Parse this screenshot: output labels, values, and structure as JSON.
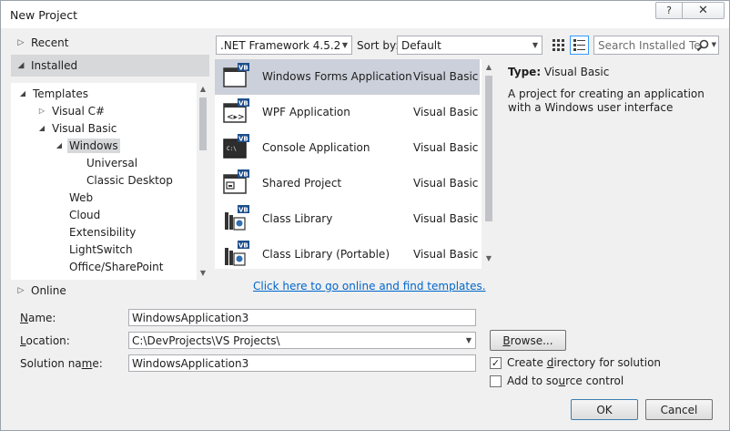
{
  "window": {
    "title": "New Project",
    "help_glyph": "?",
    "close_glyph": "✕"
  },
  "nav": {
    "sections": [
      {
        "label": "Recent",
        "arrow": "▷"
      },
      {
        "label": "Installed",
        "arrow": "◢"
      },
      {
        "label": "Online",
        "arrow": "▷"
      }
    ],
    "tree": [
      {
        "label": "Templates",
        "arrow": "◢",
        "level": 0
      },
      {
        "label": "Visual C#",
        "arrow": "▷",
        "level": 1
      },
      {
        "label": "Visual Basic",
        "arrow": "◢",
        "level": 1
      },
      {
        "label": "Windows",
        "arrow": "◢",
        "level": 2,
        "selected": true
      },
      {
        "label": "Universal",
        "arrow": "",
        "level": 3
      },
      {
        "label": "Classic Desktop",
        "arrow": "",
        "level": 3
      },
      {
        "label": "Web",
        "arrow": "",
        "level": 2
      },
      {
        "label": "Cloud",
        "arrow": "",
        "level": 2
      },
      {
        "label": "Extensibility",
        "arrow": "",
        "level": 2
      },
      {
        "label": "LightSwitch",
        "arrow": "",
        "level": 2
      },
      {
        "label": "Office/SharePoint",
        "arrow": "",
        "level": 2
      }
    ]
  },
  "toolbar": {
    "framework": ".NET Framework 4.5.2",
    "sort_label": "Sort by:",
    "sort_value": "Default",
    "search_placeholder": "Search Installed Te"
  },
  "templates": [
    {
      "name": "Windows Forms Application",
      "lang": "Visual Basic",
      "icon": "windows-forms-icon",
      "selected": true
    },
    {
      "name": "WPF Application",
      "lang": "Visual Basic",
      "icon": "wpf-icon"
    },
    {
      "name": "Console Application",
      "lang": "Visual Basic",
      "icon": "console-icon"
    },
    {
      "name": "Shared Project",
      "lang": "Visual Basic",
      "icon": "shared-project-icon"
    },
    {
      "name": "Class Library",
      "lang": "Visual Basic",
      "icon": "class-library-icon"
    },
    {
      "name": "Class Library (Portable)",
      "lang": "Visual Basic",
      "icon": "portable-class-library-icon"
    }
  ],
  "online_link": "Click here to go online and find templates.",
  "description": {
    "type_label": "Type:",
    "type_value": "Visual Basic",
    "text": "A project for creating an application with a Windows user interface"
  },
  "form": {
    "name_label": {
      "access": "N",
      "rest": "ame:"
    },
    "location_label": {
      "access": "L",
      "rest": "ocation:"
    },
    "solution_label": {
      "pre": "Solution na",
      "access": "m",
      "rest": "e:"
    },
    "name_value": "WindowsApplication3",
    "location_value": "C:\\DevProjects\\VS Projects\\",
    "solution_value": "WindowsApplication3",
    "browse": {
      "access": "B",
      "rest": "rowse..."
    },
    "create_dir": {
      "pre": "Create ",
      "access": "d",
      "rest": "irectory for solution",
      "checked": true
    },
    "source_control": {
      "pre": "Add to so",
      "access": "u",
      "rest": "rce control",
      "checked": false
    },
    "ok": "OK",
    "cancel": "Cancel"
  },
  "colors": {
    "link": "#0066cc",
    "selection": "#ccd0da",
    "accent": "#3399ff"
  }
}
